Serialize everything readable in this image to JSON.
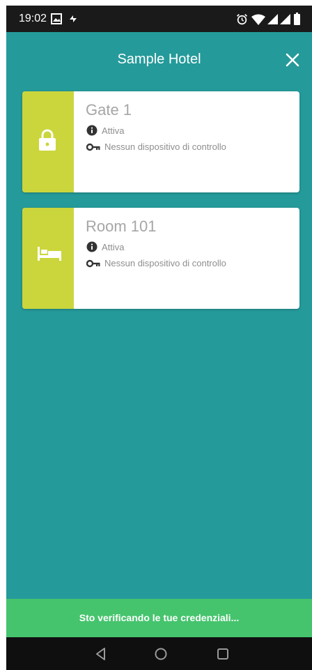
{
  "status_bar": {
    "time": "19:02",
    "icons": [
      "gallery-notification-icon",
      "sync-notification-icon",
      "alarm-icon",
      "wifi-icon",
      "signal-icon",
      "signal-icon",
      "battery-icon"
    ]
  },
  "app_bar": {
    "title": "Sample Hotel",
    "close_icon": "close-icon"
  },
  "cards": [
    {
      "name": "Gate 1",
      "icon": "lock-icon",
      "status": "Attiva",
      "status_icon": "info-icon",
      "device": "Nessun dispositivo di controllo",
      "device_icon": "key-icon"
    },
    {
      "name": "Room 101",
      "icon": "bed-icon",
      "status": "Attiva",
      "status_icon": "info-icon",
      "device": "Nessun dispositivo di controllo",
      "device_icon": "key-icon"
    }
  ],
  "snackbar": {
    "message": "Sto verificando le tue credenziali..."
  },
  "navigation_bar": {
    "buttons": [
      "back-icon",
      "home-icon",
      "recents-icon"
    ]
  },
  "colors": {
    "background": "#259a9a",
    "card_accent": "#cbd63c",
    "snackbar": "#45c46d",
    "status_bar": "#1a1a1a"
  }
}
